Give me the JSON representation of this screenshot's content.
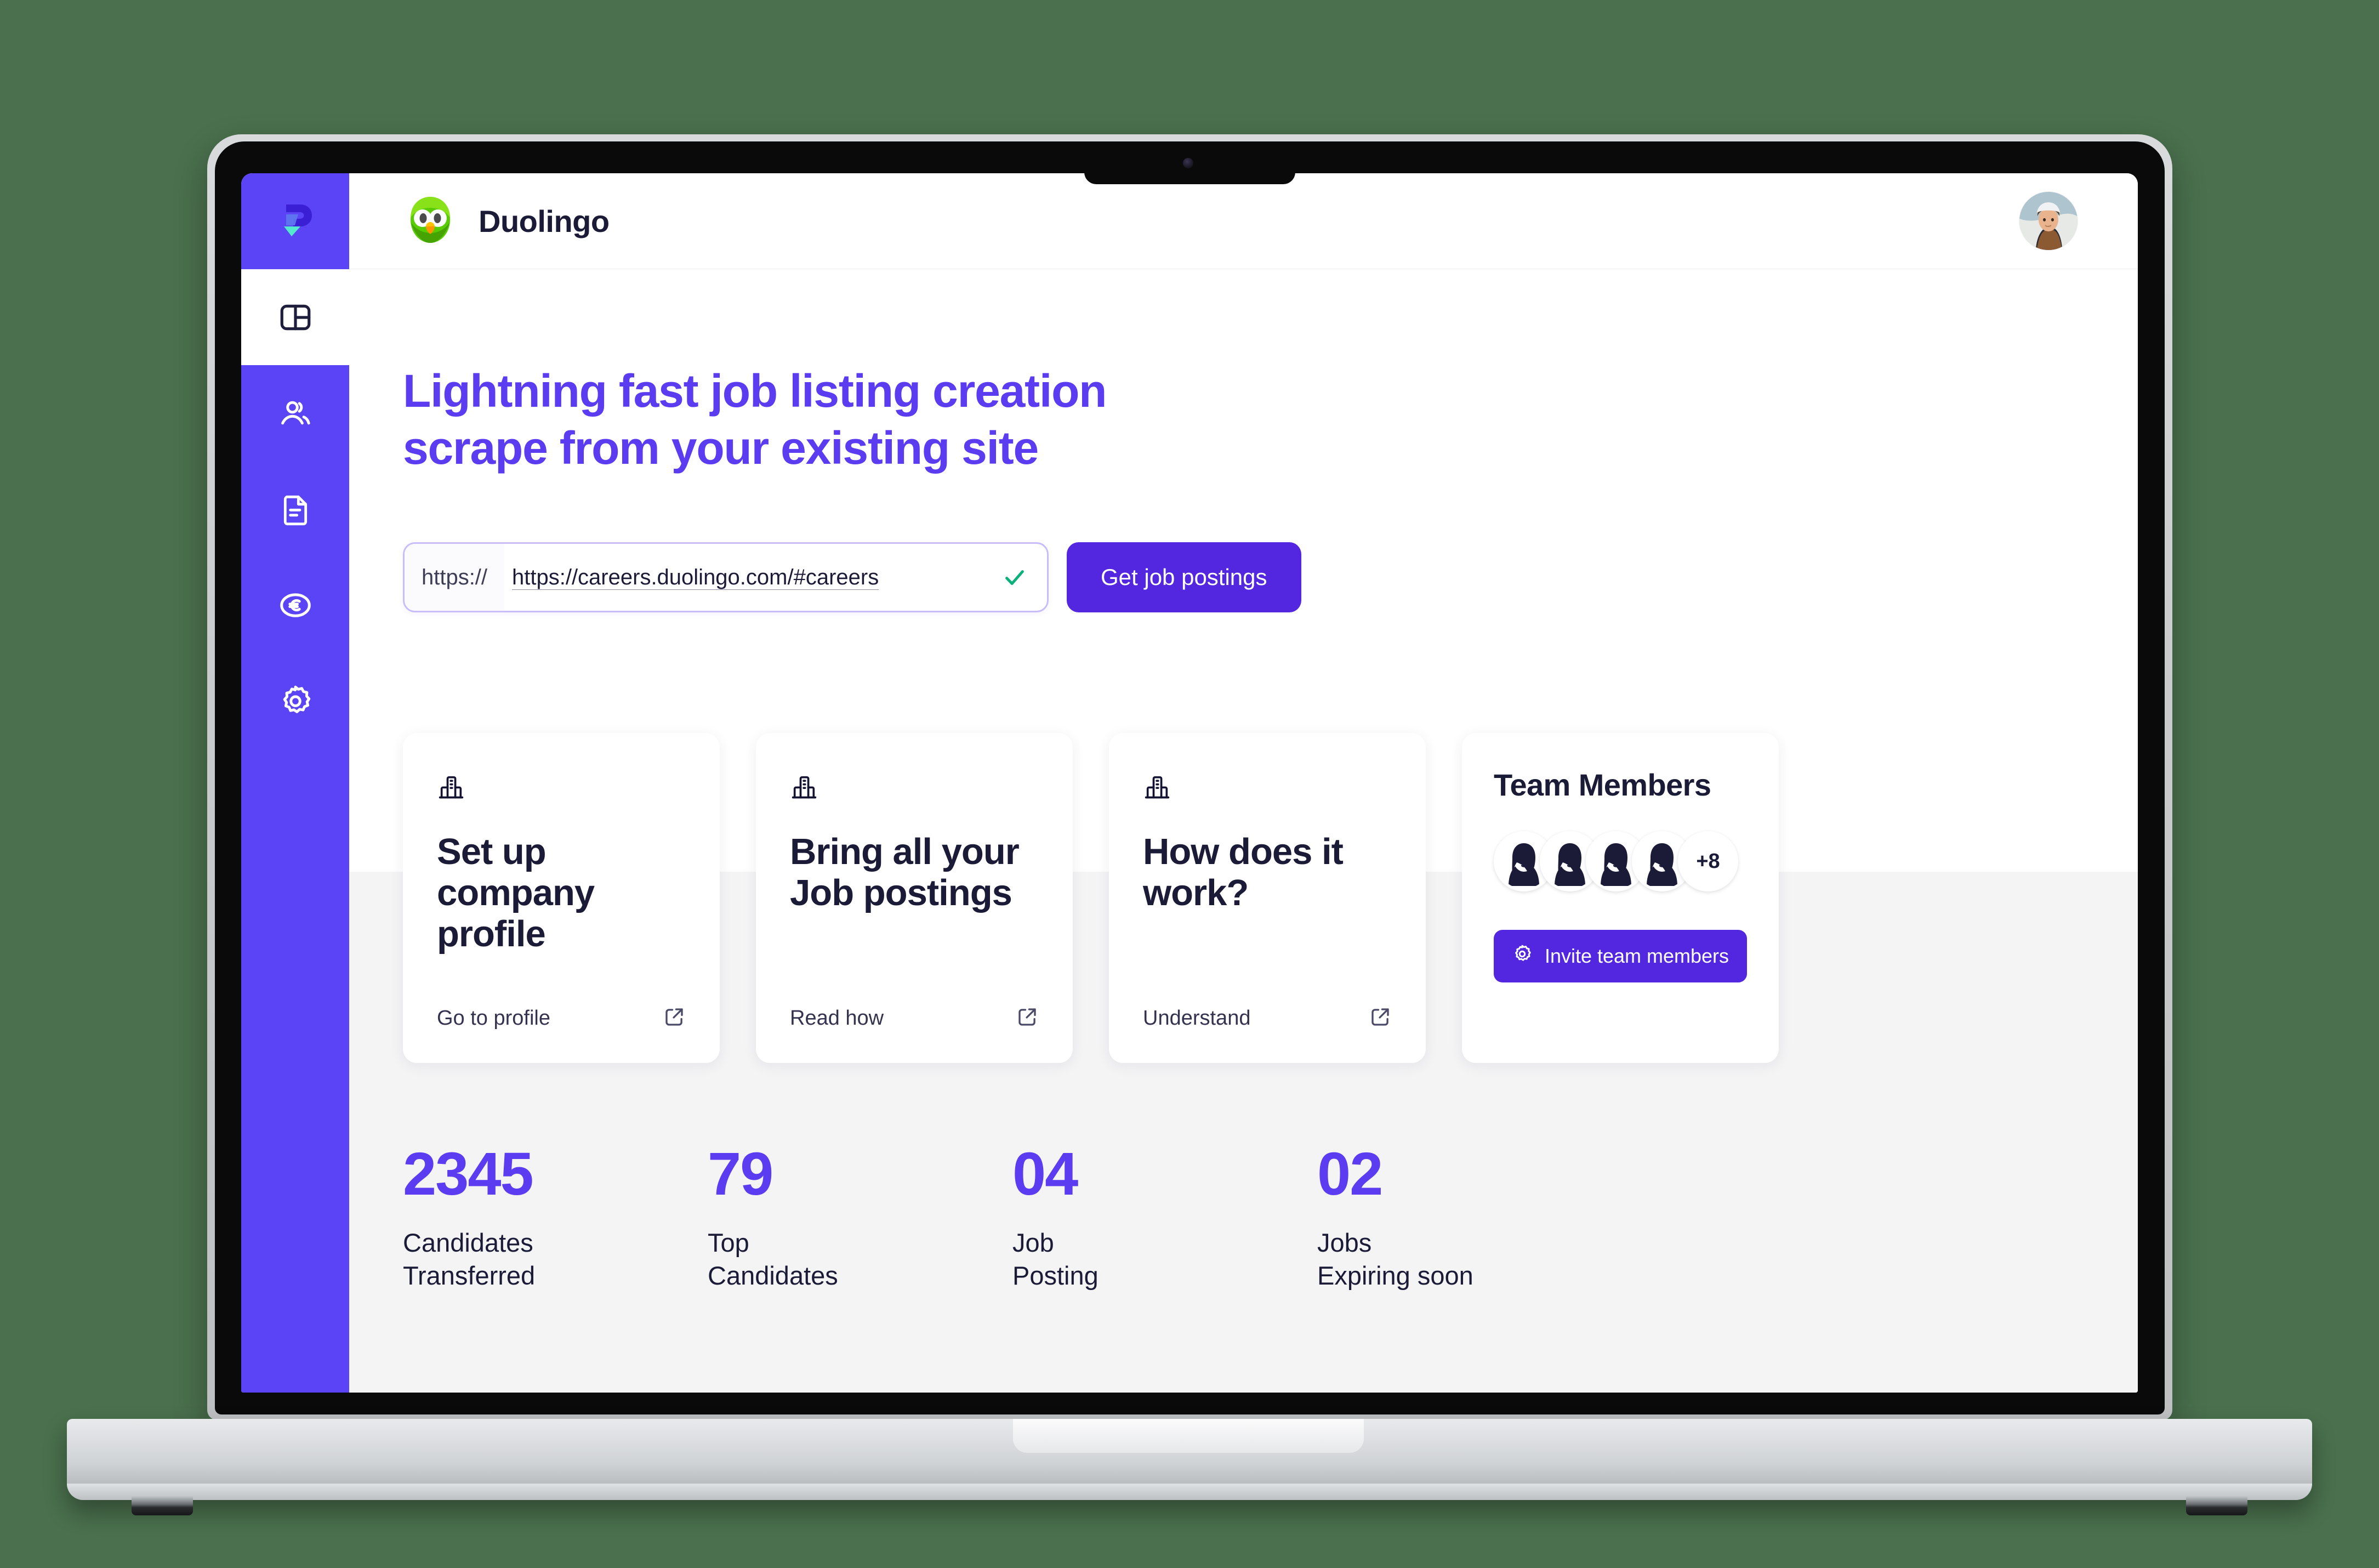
{
  "app": {
    "brand_name": "Duolingo",
    "logo_icon": "duolingo-owl-icon",
    "product_logo_icon": "product-p-logo-icon",
    "user_avatar_icon": "user-avatar-photo"
  },
  "sidebar": {
    "items": [
      {
        "icon": "dashboard-layout-icon",
        "name": "dashboard",
        "active": true
      },
      {
        "icon": "people-icon",
        "name": "candidates",
        "active": false
      },
      {
        "icon": "document-icon",
        "name": "documents",
        "active": false
      },
      {
        "icon": "euro-coin-icon",
        "name": "billing",
        "active": false
      },
      {
        "icon": "gear-icon",
        "name": "settings",
        "active": false
      }
    ]
  },
  "hero": {
    "line1": "Lightning fast job listing creation",
    "line2": "scrape from your existing site",
    "color": "#5b3cf0"
  },
  "url_form": {
    "prefix": "https://",
    "value": "https://careers.duolingo.com/#careers",
    "placeholder": "https://careers.duolingo.com/#careers",
    "valid_icon": "check-icon",
    "valid_color": "#0bb07b",
    "submit_label": "Get job postings",
    "submit_color": "#5326e0"
  },
  "cards": [
    {
      "icon": "building-icon",
      "title": "Set up company profile",
      "link_label": "Go to profile",
      "link_icon": "external-link-icon"
    },
    {
      "icon": "building-icon",
      "title": "Bring all your Job postings",
      "link_label": "Read how",
      "link_icon": "external-link-icon"
    },
    {
      "icon": "building-icon",
      "title": "How does it work?",
      "link_label": "Understand",
      "link_icon": "external-link-icon"
    }
  ],
  "team": {
    "title": "Team Members",
    "avatar_count": 4,
    "overflow_label": "+8",
    "invite_label": "Invite team members",
    "invite_icon": "gear-icon",
    "invite_color": "#5326e0"
  },
  "stats": [
    {
      "value": "2345",
      "label_line1": "Candidates",
      "label_line2": "Transferred"
    },
    {
      "value": "79",
      "label_line1": "Top",
      "label_line2": "Candidates"
    },
    {
      "value": "04",
      "label_line1": "Job",
      "label_line2": "Posting"
    },
    {
      "value": "02",
      "label_line1": "Jobs",
      "label_line2": "Expiring soon"
    }
  ],
  "theme": {
    "background": "#4a704d",
    "sidebar": "#5b44f5",
    "accent": "#5326e0",
    "heading": "#5b3cf0",
    "text_dark": "#1b1b38",
    "panel_gray": "#f4f4f5"
  }
}
